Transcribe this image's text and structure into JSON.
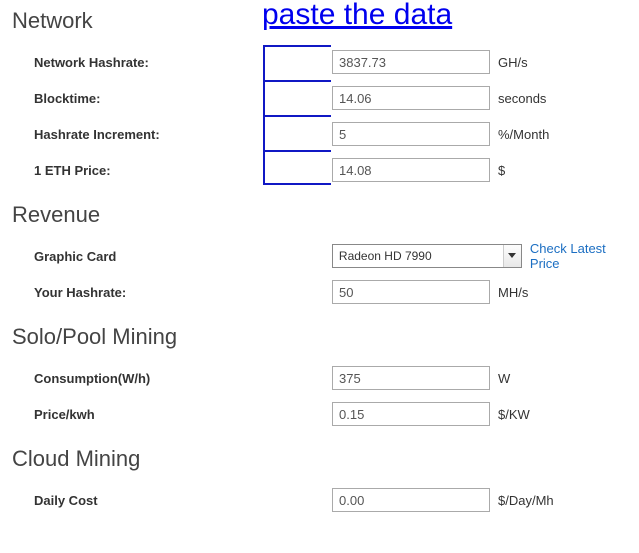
{
  "annotation": {
    "title": "paste the data"
  },
  "network": {
    "title": "Network",
    "hashrate_label": "Network Hashrate:",
    "hashrate_value": "3837.73",
    "hashrate_unit": "GH/s",
    "blocktime_label": "Blocktime:",
    "blocktime_value": "14.06",
    "blocktime_unit": "seconds",
    "increment_label": "Hashrate Increment:",
    "increment_value": "5",
    "increment_unit": "%/Month",
    "price_label": "1 ETH Price:",
    "price_value": "14.08",
    "price_unit": "$"
  },
  "revenue": {
    "title": "Revenue",
    "card_label": "Graphic Card",
    "card_selected": "Radeon HD 7990",
    "card_link": "Check Latest Price",
    "hashrate_label": "Your Hashrate:",
    "hashrate_value": "50",
    "hashrate_unit": "MH/s"
  },
  "mining": {
    "title": "Solo/Pool Mining",
    "cons_label": "Consumption(W/h)",
    "cons_value": "375",
    "cons_unit": "W",
    "kwh_label": "Price/kwh",
    "kwh_value": "0.15",
    "kwh_unit": "$/KW"
  },
  "cloud": {
    "title": "Cloud Mining",
    "daily_label": "Daily Cost",
    "daily_value": "0.00",
    "daily_unit": "$/Day/Mh"
  }
}
